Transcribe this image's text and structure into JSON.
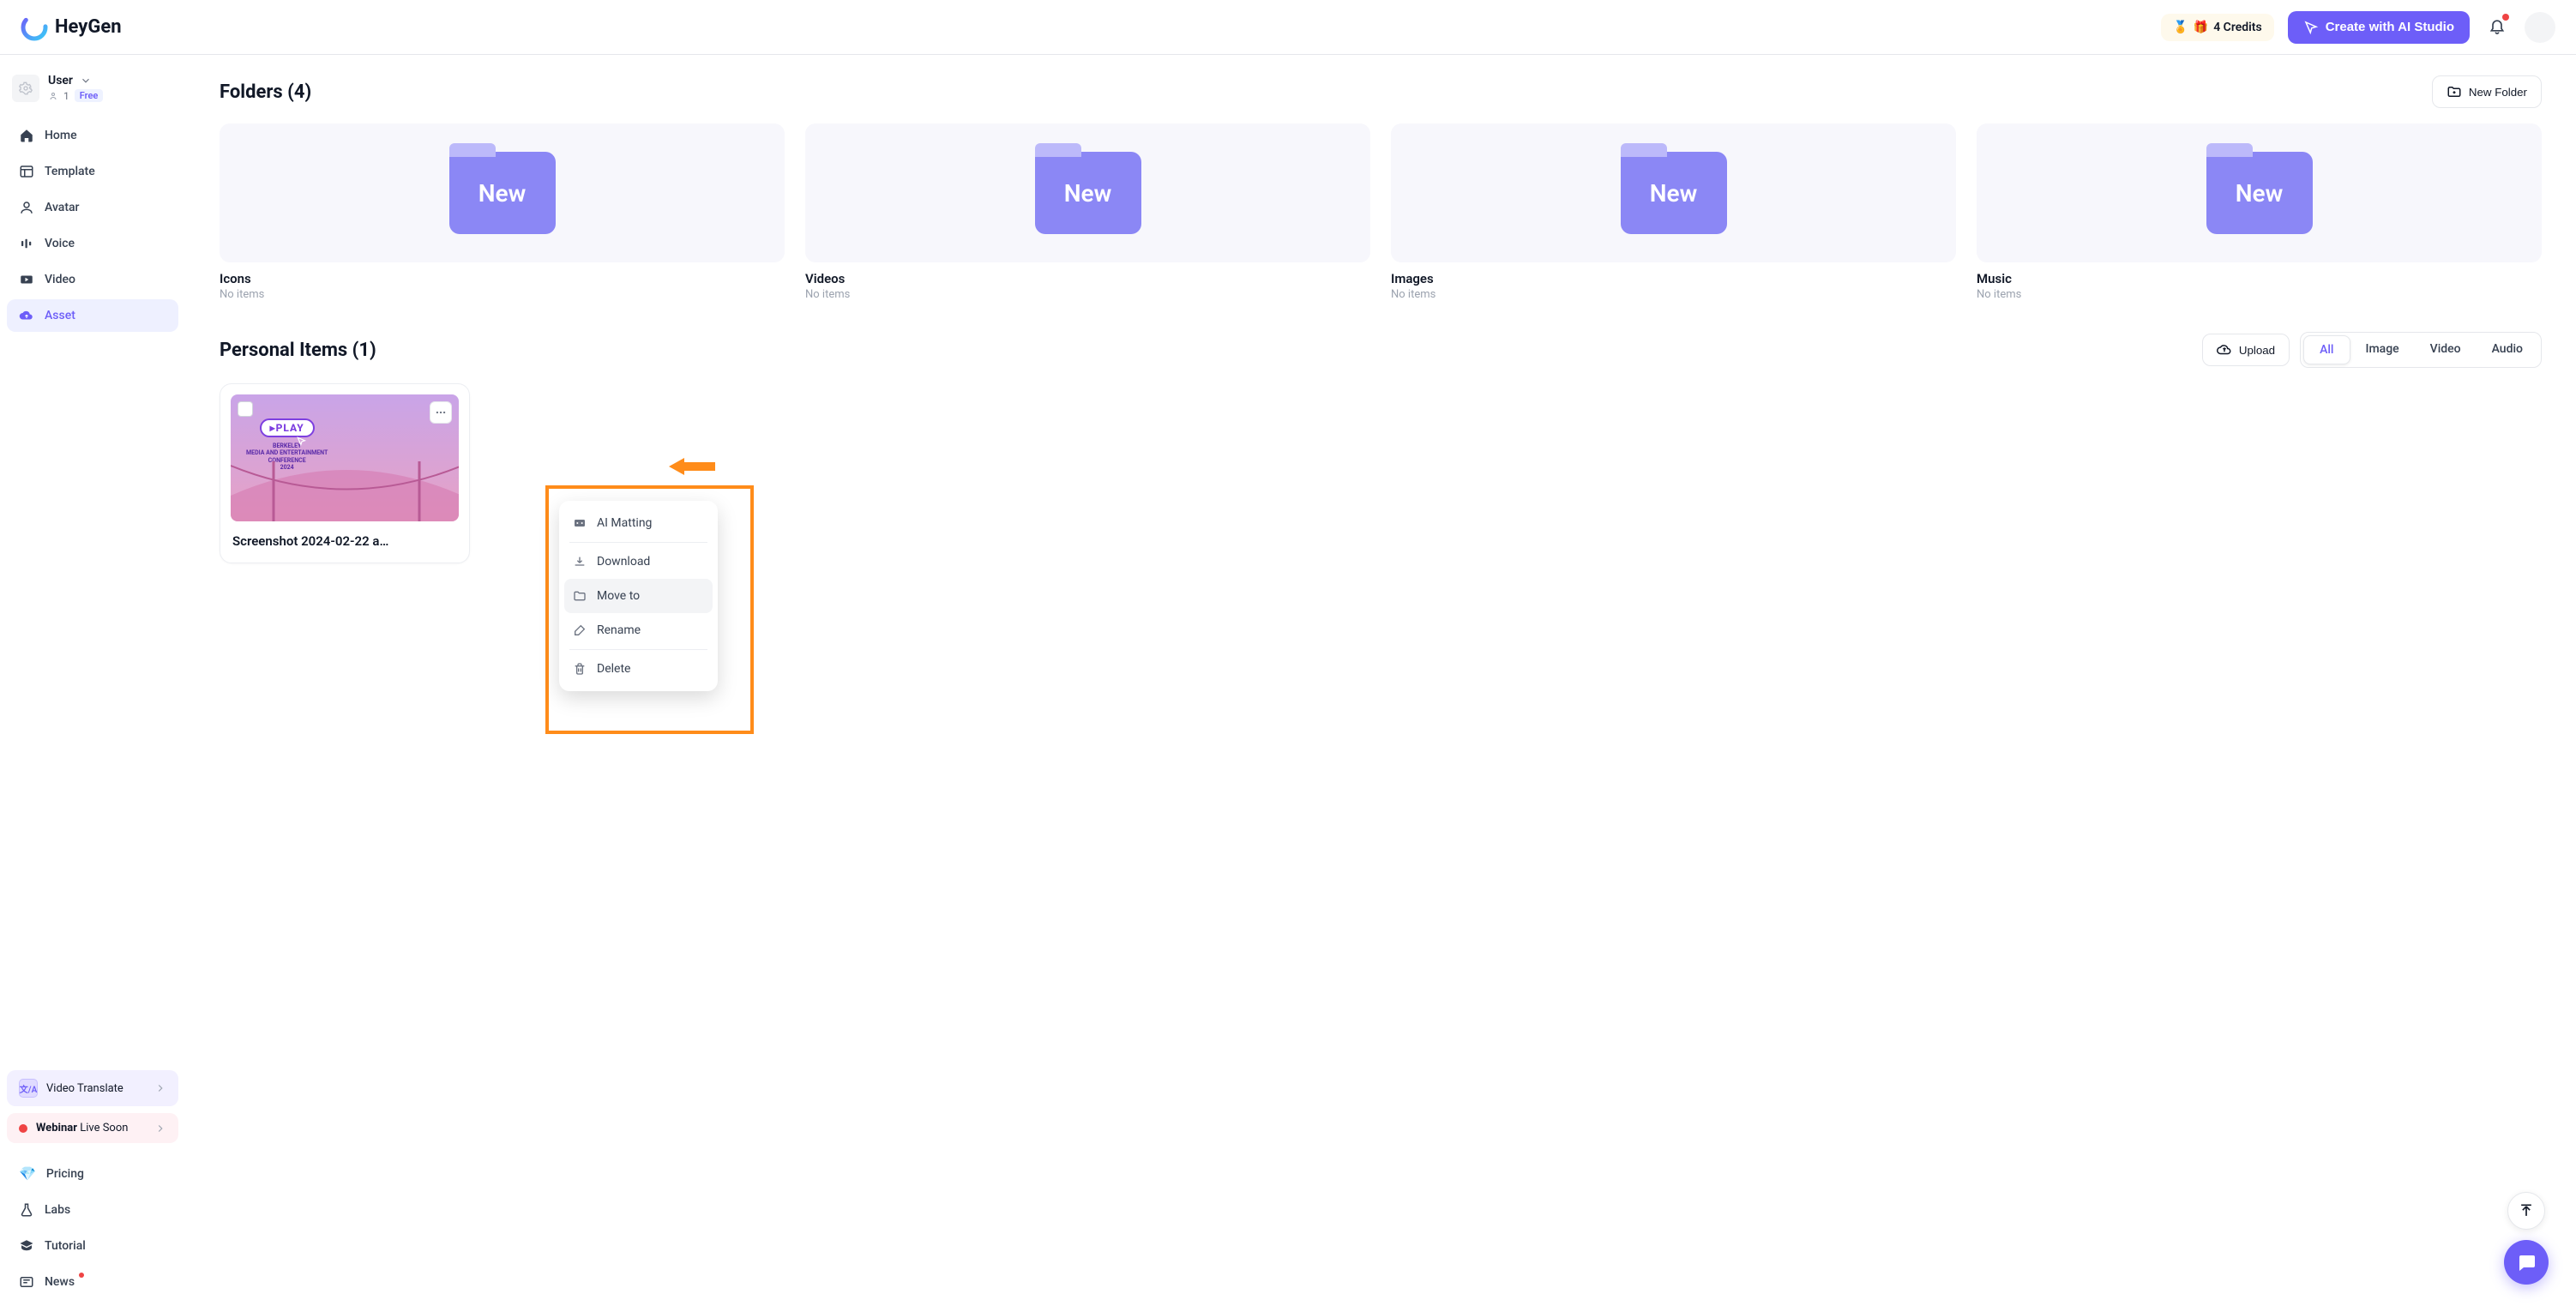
{
  "header": {
    "brand": "HeyGen",
    "credits_label": "4 Credits",
    "create_label": "Create with AI Studio"
  },
  "user": {
    "name": "User",
    "members": "1",
    "plan": "Free"
  },
  "sidebar": {
    "items": [
      {
        "label": "Home"
      },
      {
        "label": "Template"
      },
      {
        "label": "Avatar"
      },
      {
        "label": "Voice"
      },
      {
        "label": "Video"
      },
      {
        "label": "Asset"
      }
    ],
    "promo_translate": "Video Translate",
    "promo_webinar_bold": "Webinar",
    "promo_webinar_rest": "Live Soon",
    "lower": [
      {
        "label": "Pricing"
      },
      {
        "label": "Labs"
      },
      {
        "label": "Tutorial"
      },
      {
        "label": "News"
      }
    ]
  },
  "folders": {
    "title": "Folders (4)",
    "new_folder": "New Folder",
    "thumb_text": "New",
    "list": [
      {
        "name": "Icons",
        "sub": "No items"
      },
      {
        "name": "Videos",
        "sub": "No items"
      },
      {
        "name": "Images",
        "sub": "No items"
      },
      {
        "name": "Music",
        "sub": "No items"
      }
    ]
  },
  "personal": {
    "title": "Personal Items (1)",
    "upload": "Upload",
    "filters": [
      "All",
      "Image",
      "Video",
      "Audio"
    ],
    "item_name": "Screenshot 2024-02-22 a…",
    "thumb_play": "PLAY",
    "thumb_conf_l1": "BERKELEY",
    "thumb_conf_l2": "MEDIA AND ENTERTAINMENT",
    "thumb_conf_l3": "CONFERENCE",
    "thumb_conf_l4": "2024"
  },
  "context_menu": {
    "ai_matting": "AI Matting",
    "download": "Download",
    "move_to": "Move to",
    "rename": "Rename",
    "delete": "Delete"
  }
}
